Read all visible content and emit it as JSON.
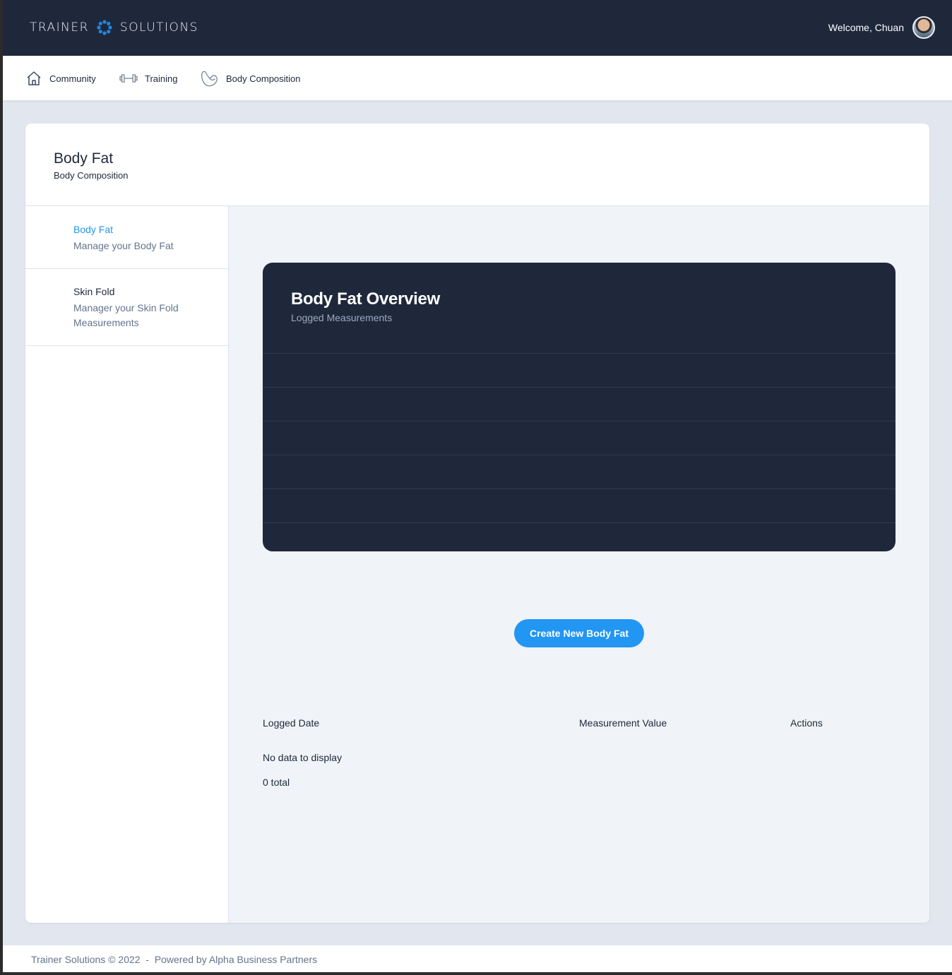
{
  "header": {
    "logo_left": "TRAINER",
    "logo_right": "SOLUTIONS",
    "welcome": "Welcome, Chuan",
    "colors": {
      "bar": "#1f283b",
      "logo_mark": "#1e88e5"
    }
  },
  "nav": {
    "items": [
      {
        "label": "Community",
        "icon": "home-icon"
      },
      {
        "label": "Training",
        "icon": "dumbbell-icon"
      },
      {
        "label": "Body Composition",
        "icon": "flexed-arm-icon"
      }
    ]
  },
  "page": {
    "title": "Body Fat",
    "subtitle": "Body Composition"
  },
  "sidebar": {
    "items": [
      {
        "title": "Body Fat",
        "desc": "Manage your Body Fat",
        "active": true
      },
      {
        "title": "Skin Fold",
        "desc": "Manager your Skin Fold Measurements",
        "active": false
      }
    ],
    "colors": {
      "active": "#2196f3"
    }
  },
  "overview": {
    "title": "Body Fat Overview",
    "subtitle": "Logged Measurements"
  },
  "actions": {
    "create_label": "Create New Body Fat"
  },
  "table": {
    "columns": [
      "Logged Date",
      "Measurement Value",
      "Actions"
    ],
    "empty_text": "No data to display",
    "total_text": "0 total"
  },
  "footer": {
    "text": "Trainer Solutions © 2022  -  Powered by Alpha Business Partners"
  }
}
